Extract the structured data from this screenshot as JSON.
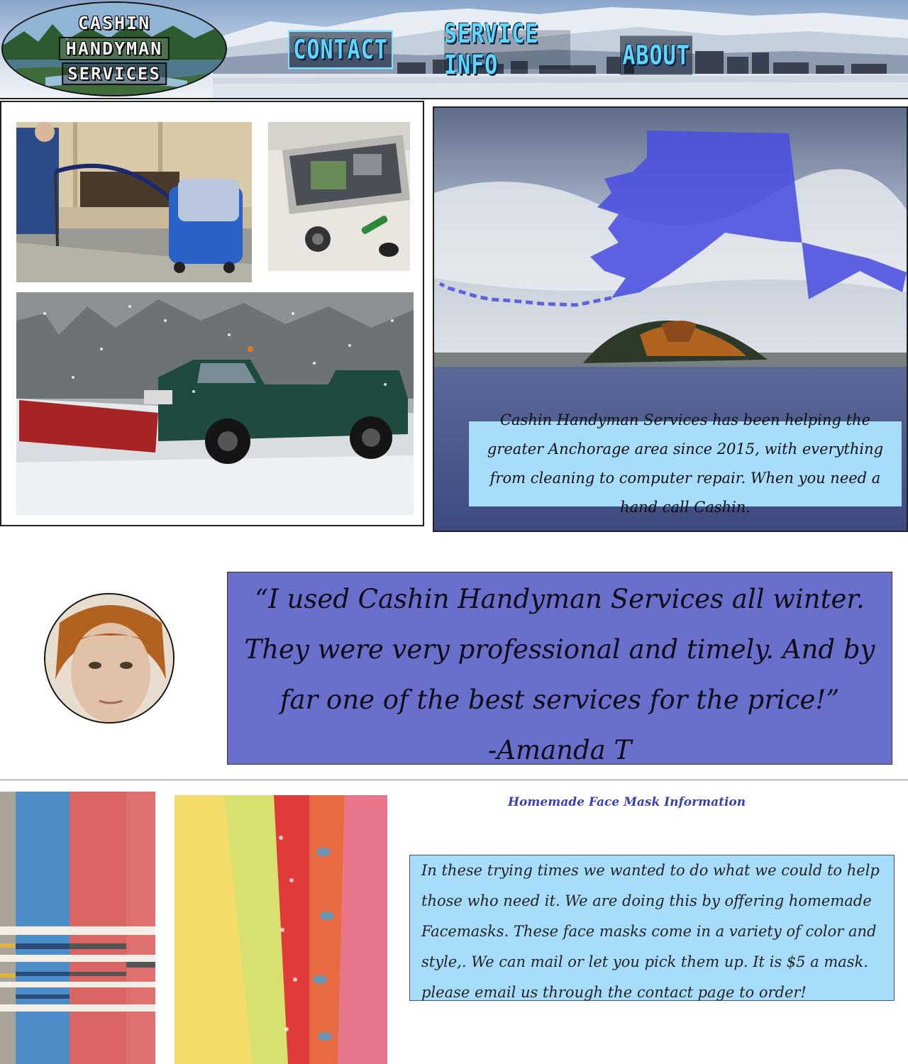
{
  "header": {
    "logo_lines": [
      "CASHIN",
      "HANDYMAN",
      "SERVICES"
    ],
    "nav": {
      "contact": "CONTACT",
      "service_info": "SERVICE INFO",
      "about": "ABOUT"
    }
  },
  "about": {
    "text": "Cashin Handyman Services has been helping the greater Anchorage area since 2015, with everything from cleaning to computer repair. When you need a hand call Cashin."
  },
  "testimonial": {
    "quote": "“I used Cashin Handyman Services all winter. They were very professional and timely. And by far one of the best services for the price!”",
    "author": "-Amanda T"
  },
  "masks": {
    "title": "Homemade Face Mask Information",
    "text": "In these trying times we wanted to do what we could to help those who need it. We are doing this by offering homemade Facemasks. These face masks come in a variety of color and style,. We can mail or let you pick them up. It is $5 a mask. please email us through the contact page to order!"
  },
  "colors": {
    "nav_text": "#5fd5ff",
    "info_box": "#a8dcfb",
    "quote_box": "#6a6fcb",
    "alaska_shape": "#4a4fe0",
    "mask_title": "#3b3fb3"
  }
}
